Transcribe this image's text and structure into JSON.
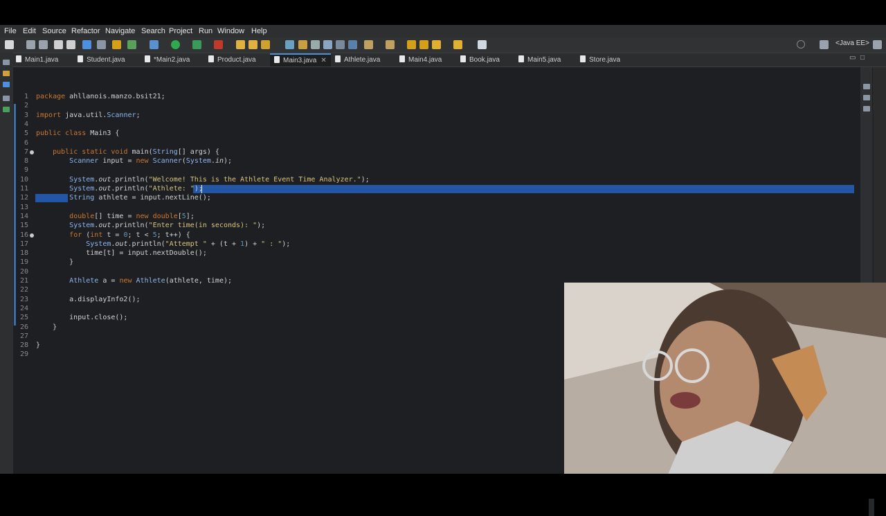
{
  "menu": [
    "File",
    "Edit",
    "Source",
    "Refactor",
    "Navigate",
    "Search",
    "Project",
    "Run",
    "Window",
    "Help"
  ],
  "perspective": "<Java EE>",
  "tabs": [
    {
      "label": "Main1.java",
      "active": false
    },
    {
      "label": "Student.java",
      "active": false
    },
    {
      "label": "*Main2.java",
      "active": false
    },
    {
      "label": "Product.java",
      "active": false
    },
    {
      "label": "Main3.java",
      "active": true
    },
    {
      "label": "Athlete.java",
      "active": false
    },
    {
      "label": "Main4.java",
      "active": false
    },
    {
      "label": "Book.java",
      "active": false
    },
    {
      "label": "Main5.java",
      "active": false
    },
    {
      "label": "Store.java",
      "active": false
    }
  ],
  "editor": {
    "lines": [
      "package ahllanois.manzo.bsit21;",
      "",
      "import java.util.Scanner;",
      "",
      "public class Main3 {",
      "",
      "    public static void main(String[] args) {",
      "        Scanner input = new Scanner(System.in);",
      "",
      "        System.out.println(\"Welcome! This is the Athlete Event Time Analyzer.\");",
      "        System.out.println(\"Athlete: \");",
      "        String athlete = input.nextLine();",
      "",
      "        double[] time = new double[5];",
      "        System.out.println(\"Enter time(in seconds): \");",
      "        for (int t = 0; t < 5; t++) {",
      "            System.out.println(\"Attempt \" + (t + 1) + \" : \");",
      "            time[t] = input.nextDouble();",
      "        }",
      "",
      "        Athlete a = new Athlete(athlete, time);",
      "",
      "        a.displayInfo2();",
      "",
      "        input.close();",
      "    }",
      "",
      "}",
      ""
    ],
    "line_numbers": [
      "1",
      "2",
      "3",
      "4",
      "5",
      "6",
      "7",
      "8",
      "9",
      "10",
      "11",
      "12",
      "13",
      "14",
      "15",
      "16",
      "17",
      "18",
      "19",
      "20",
      "21",
      "22",
      "23",
      "24",
      "25",
      "26",
      "27",
      "28",
      "29"
    ]
  },
  "colors": {
    "keyword": "#cc7832",
    "type": "#8db5f0",
    "string": "#d7c57e",
    "selection": "#2456a6",
    "background": "#1e1f22"
  }
}
